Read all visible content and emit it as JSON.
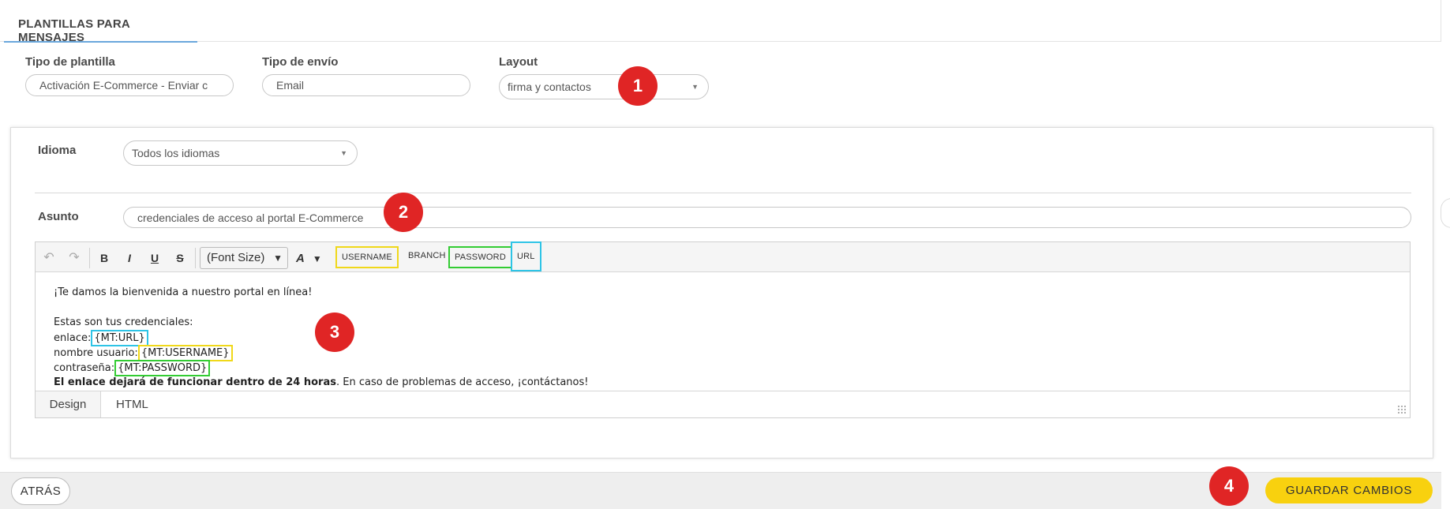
{
  "header": {
    "title": "PLANTILLAS PARA MENSAJES"
  },
  "top_form": {
    "template_type": {
      "label": "Tipo de plantilla",
      "value": "Activación E-Commerce - Enviar c"
    },
    "send_type": {
      "label": "Tipo de envío",
      "value": "Email"
    },
    "layout": {
      "label": "Layout",
      "value": "firma y contactos"
    }
  },
  "language": {
    "label": "Idioma",
    "value": "Todos los idiomas"
  },
  "subject": {
    "label": "Asunto",
    "value": "credenciales de acceso al portal E-Commerce"
  },
  "toolbar": {
    "undo_icon": "↶",
    "redo_icon": "↷",
    "bold": "B",
    "italic": "I",
    "underline": "U",
    "strike": "S",
    "font_size": "(Font Size)",
    "tokens": [
      "USERNAME",
      "BRANCH",
      "PASSWORD",
      "URL"
    ]
  },
  "body": {
    "line1": "¡Te damos la bienvenida a nuestro portal en línea!",
    "line2": "Estas son tus credenciales:",
    "link_label": "enlace:",
    "link_token": "{MT:URL}",
    "user_label": "nombre usuario:",
    "user_token": "{MT:USERNAME}",
    "pass_label": "contraseña:",
    "pass_token": "{MT:PASSWORD}",
    "bold_text": "El enlace dejará de funcionar dentro de 24 horas",
    "rest_text": ". En caso de problemas de acceso, ¡contáctanos!"
  },
  "editor_tabs": {
    "design": "Design",
    "html": "HTML"
  },
  "buttons": {
    "back": "ATRÁS",
    "save": "GUARDAR CAMBIOS"
  },
  "markers": [
    "1",
    "2",
    "3",
    "4"
  ],
  "colors": {
    "accent_yellow": "#f8d10f",
    "marker_red": "#e02525",
    "tab_underline": "#6aa7dc"
  }
}
